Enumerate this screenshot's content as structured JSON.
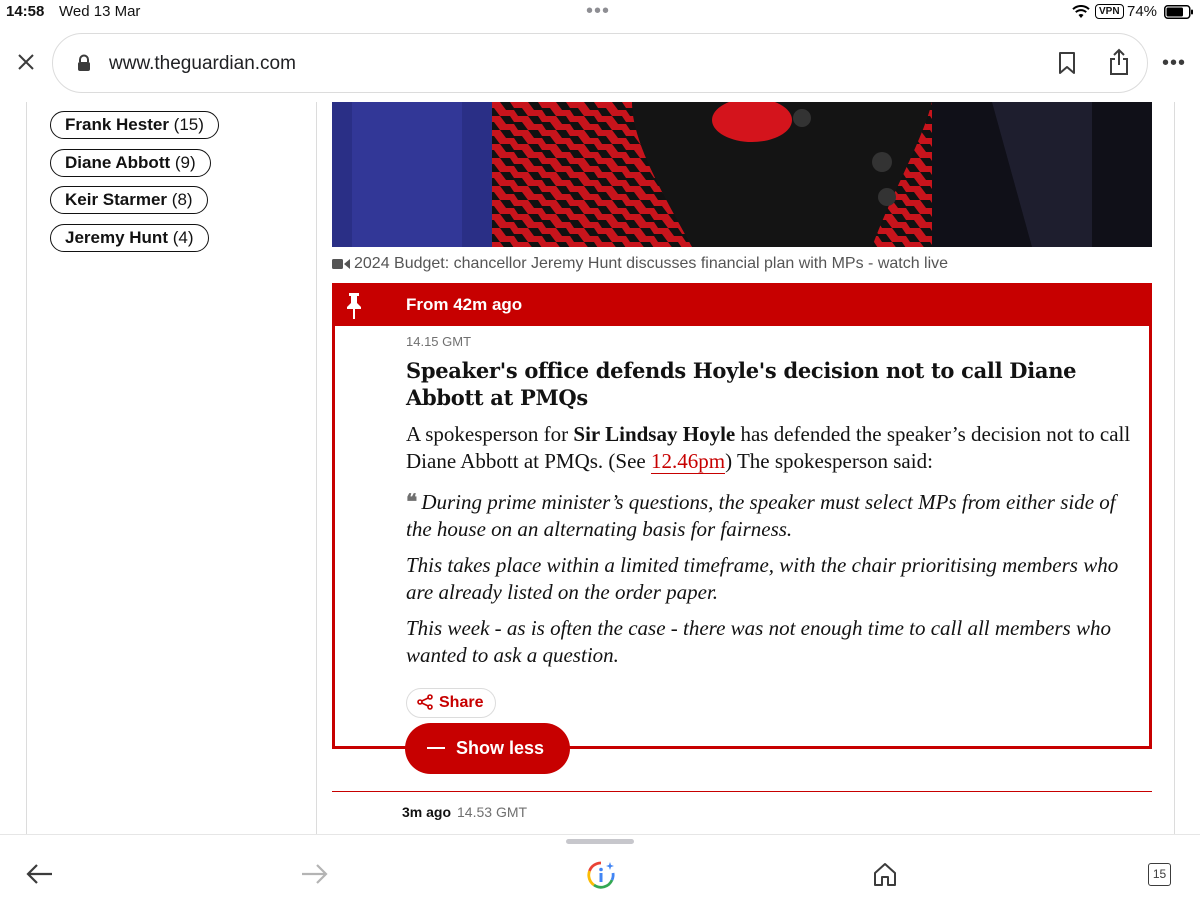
{
  "status_bar": {
    "time": "14:58",
    "date": "Wed 13 Mar",
    "vpn": "VPN",
    "battery": "74%"
  },
  "browser": {
    "url": "www.theguardian.com"
  },
  "sidebar": {
    "tags": [
      {
        "name": "Frank Hester",
        "count": "(15)"
      },
      {
        "name": "Diane Abbott",
        "count": "(9)"
      },
      {
        "name": "Keir Starmer",
        "count": "(8)"
      },
      {
        "name": "Jeremy Hunt",
        "count": "(4)"
      }
    ]
  },
  "media": {
    "caption": "2024 Budget: chancellor Jeremy Hunt discusses financial plan with MPs - watch live"
  },
  "pinned_post": {
    "banner": "From 42m ago",
    "timestamp": "14.15 GMT",
    "headline": "Speaker's office defends Hoyle's decision not to call Diane Abbott at PMQs",
    "intro_before": "A spokesperson for ",
    "intro_bold": "Sir Lindsay Hoyle",
    "intro_mid": " has defended the speaker’s decision not to call Diane Abbott at PMQs. (See ",
    "intro_link": "12.46pm",
    "intro_after": ") The spokesperson said:",
    "quotes": [
      "During prime minister’s questions, the speaker must select MPs from either side of the house on an alternating basis for fairness.",
      "This takes place within a limited timeframe, with the chair prioritising members who are already listed on the order paper.",
      "This week - as is often the case - there was not enough time to call all members who wanted to ask a question."
    ],
    "share_label": "Share",
    "show_less_label": "Show less"
  },
  "next_post": {
    "ago": "3m ago",
    "timestamp": "14.53 GMT"
  },
  "toolbar": {
    "tab_count": "15"
  },
  "colors": {
    "accent": "#c70000",
    "text": "#121212",
    "muted": "#707070"
  }
}
